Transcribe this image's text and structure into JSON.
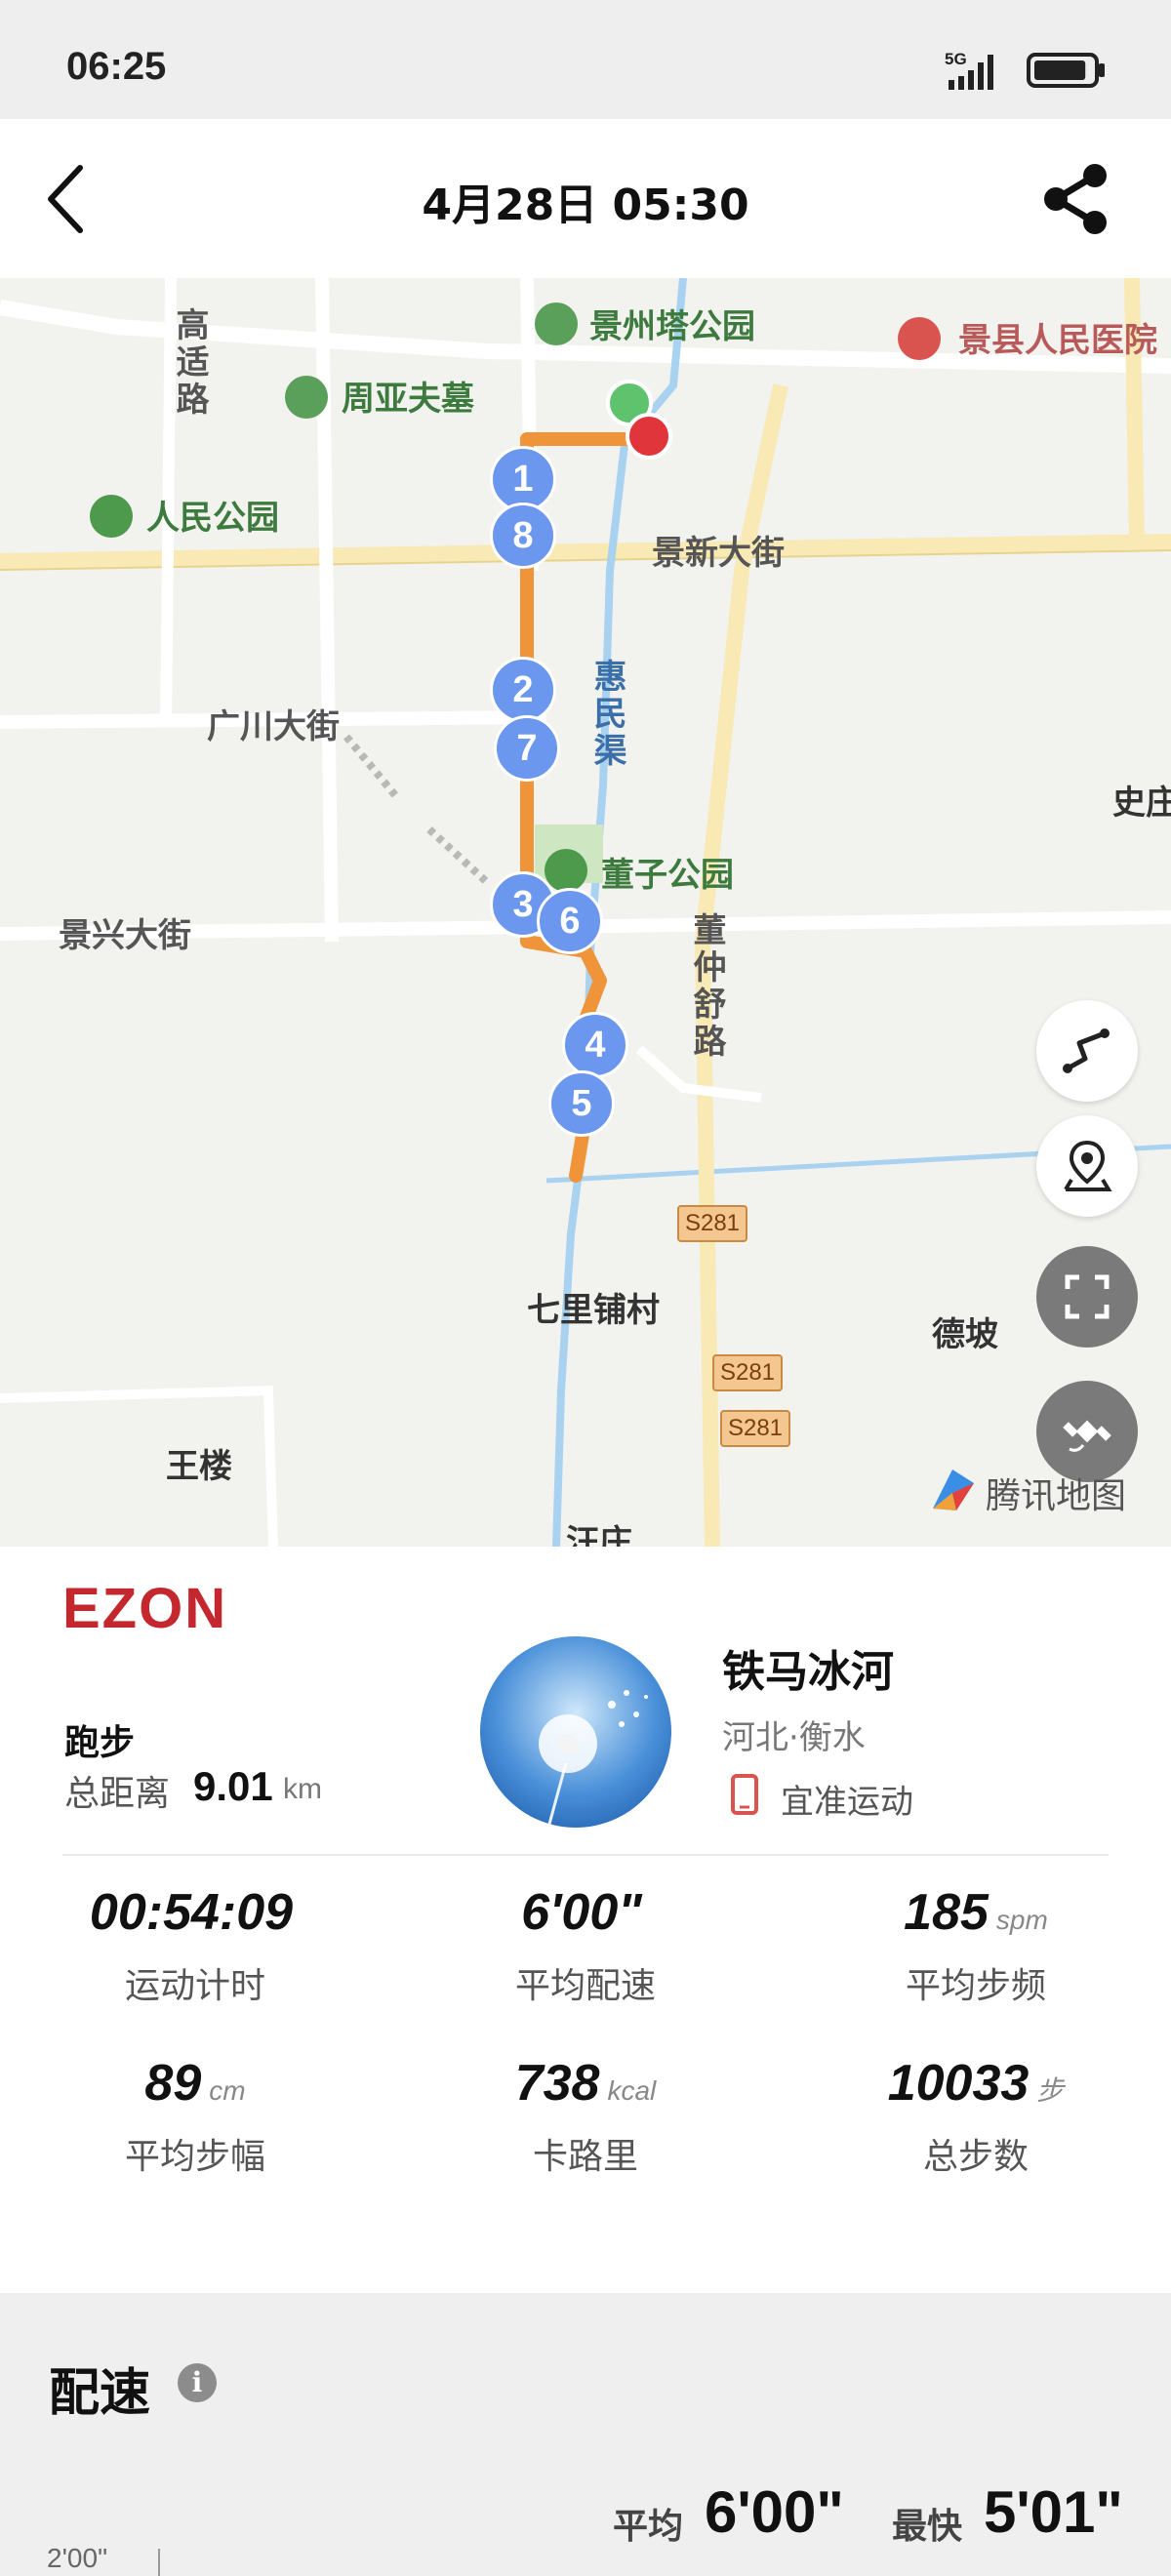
{
  "status_bar": {
    "time": "06:25",
    "network": "5G",
    "battery_level": 0.9
  },
  "header": {
    "title": "4月28日  05:30"
  },
  "map": {
    "labels": {
      "jingzhou_tower_park": "景州塔公园",
      "jingxian_hospital": "景县人民医院",
      "gaoshi_road": "高适路",
      "zhouyafu_tomb": "周亚夫墓",
      "people_park": "人民公园",
      "jingxin_street": "景新大街",
      "guangchuan_street": "广川大街",
      "huimin_canal": "惠民渠",
      "dongzi_park": "董子公园",
      "jingxing_street": "景兴大街",
      "dongzhongshu_road": "董仲舒路",
      "shizhuang": "史庄",
      "qilipu_village": "七里铺村",
      "depo": "德坡",
      "wanglou": "王楼",
      "wangzhuang": "汪庄"
    },
    "road_badges": [
      "S281",
      "S281",
      "S281"
    ],
    "km_markers": [
      "1",
      "8",
      "2",
      "7",
      "3",
      "6",
      "4",
      "5"
    ],
    "watermark": "腾讯地图",
    "colors": {
      "route": "#f0943a",
      "start": "#5fc36e",
      "end": "#e0353a",
      "marker": "#6b97ef"
    }
  },
  "summary": {
    "brand": "EZON",
    "sport": "跑步",
    "distance_label": "总距离",
    "distance_value": "9.01",
    "distance_unit": "km",
    "user_name": "铁马冰河",
    "location": "河北·衡水",
    "device": "宜准运动",
    "stats": [
      {
        "value": "00:54:09",
        "unit": "",
        "label": "运动计时"
      },
      {
        "value": "6'00\"",
        "unit": "",
        "label": "平均配速"
      },
      {
        "value": "185",
        "unit": "spm",
        "label": "平均步频"
      },
      {
        "value": "89",
        "unit": "cm",
        "label": "平均步幅"
      },
      {
        "value": "738",
        "unit": "kcal",
        "label": "卡路里"
      },
      {
        "value": "10033",
        "unit": "步",
        "label": "总步数"
      }
    ]
  },
  "pace": {
    "title": "配速",
    "avg_label": "平均",
    "avg_value": "6'00\"",
    "fastest_label": "最快",
    "fastest_value": "5'01\"",
    "axis_first_tick": "2'00\""
  }
}
